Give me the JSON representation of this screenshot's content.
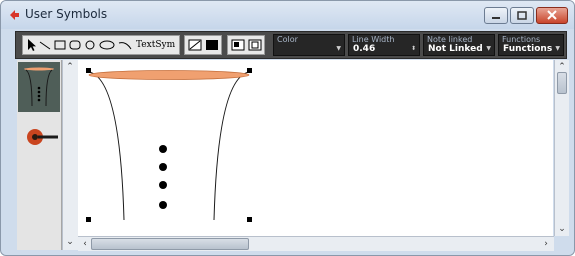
{
  "window": {
    "title": "User Symbols"
  },
  "toolbar": {
    "text_tool_label": "TextSym",
    "fields": [
      {
        "label": "Color",
        "value": ""
      },
      {
        "label": "Line Width",
        "value": "0.46"
      },
      {
        "label": "Note linked",
        "value": "Not Linked"
      },
      {
        "label": "Functions",
        "value": "Functions"
      }
    ]
  },
  "colors": {
    "accent_fill": "#f0a070",
    "toolbar_bg": "#4b4b4b",
    "selected_item": "#4f5e58"
  },
  "icons": [
    "app-icon",
    "arrow-tool-icon",
    "line-tool-icon",
    "rectangle-tool-icon",
    "rounded-rect-tool-icon",
    "circle-tool-icon",
    "ellipse-tool-icon",
    "arc-tool-icon",
    "outline-fill-icon",
    "solid-fill-icon",
    "bring-front-icon",
    "send-back-icon",
    "minimize-icon",
    "maximize-icon",
    "close-icon"
  ]
}
